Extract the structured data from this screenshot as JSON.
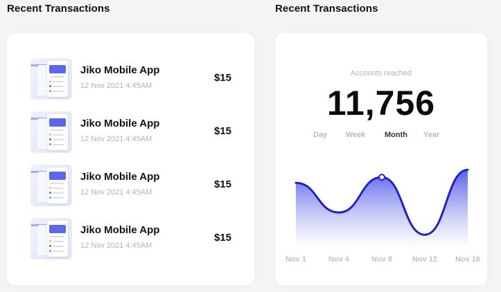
{
  "left_panel": {
    "title": "Recent Transactions",
    "transactions": [
      {
        "name": "Jiko Mobile App",
        "date": "12 Nov 2021 4:45AM",
        "amount": "$15",
        "thumb_brand": "ecurrency"
      },
      {
        "name": "Jiko Mobile App",
        "date": "12 Nov 2021 4:45AM",
        "amount": "$15",
        "thumb_brand": "ecurrency"
      },
      {
        "name": "Jiko Mobile App",
        "date": "12 Nov 2021 4:45AM",
        "amount": "$15",
        "thumb_brand": "ecurrency"
      },
      {
        "name": "Jiko Mobile App",
        "date": "12 Nov 2021 4:45AM",
        "amount": "$15",
        "thumb_brand": "ecurrency"
      }
    ]
  },
  "right_panel": {
    "title": "Recent Transactions",
    "accounts_label": "Accounts reached",
    "accounts_value": "11,756",
    "tabs": [
      {
        "label": "Day",
        "active": false
      },
      {
        "label": "Week",
        "active": false
      },
      {
        "label": "Month",
        "active": true
      },
      {
        "label": "Year",
        "active": false
      }
    ]
  },
  "colors": {
    "accent": "#5059e8",
    "line": "#2020c8",
    "background": "#f4f4f6"
  },
  "chart_data": {
    "type": "area",
    "x": [
      "Nov 1",
      "Nov 4",
      "Nov 8",
      "Nov 12",
      "Nov 16"
    ],
    "series": [
      {
        "values": [
          70,
          38,
          76,
          14,
          84
        ]
      }
    ],
    "highlight_point": "Nov 8",
    "ylim": [
      0,
      100
    ],
    "grid": false,
    "legend": "none"
  }
}
